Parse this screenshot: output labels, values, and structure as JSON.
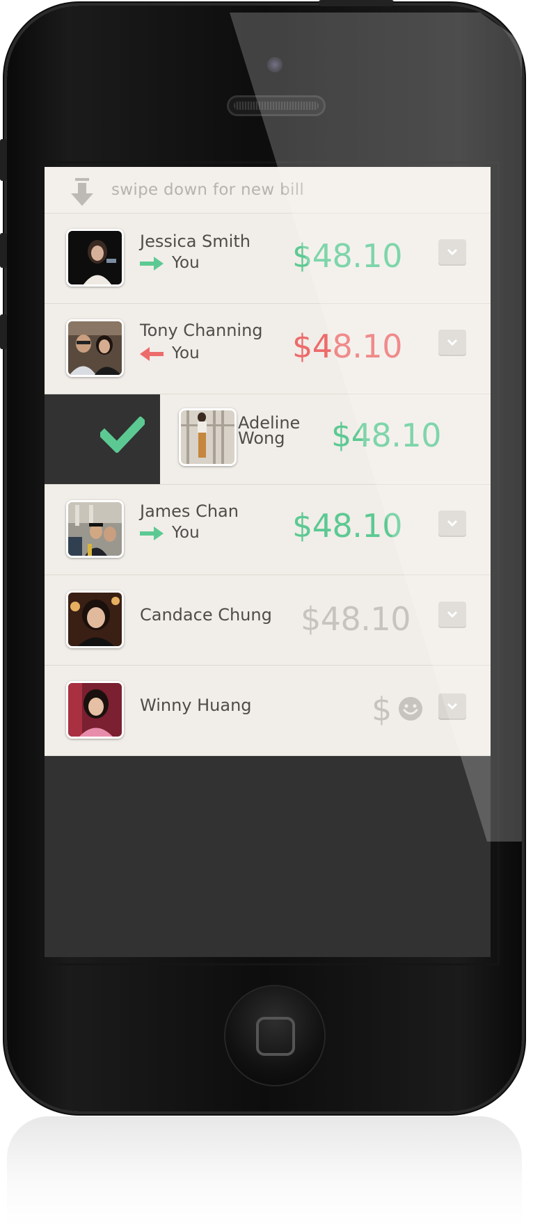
{
  "hint": {
    "text": "swipe down for new bill",
    "icon": "down-arrow-icon"
  },
  "colors": {
    "green": "#5cc993",
    "red": "#ec6b6b",
    "muted": "#c7c3bf"
  },
  "rows": [
    {
      "name": "Jessica Smith",
      "direction": "to",
      "party": "You",
      "amount": "$48.10",
      "amount_color": "green"
    },
    {
      "name": "Tony Channing",
      "direction": "from",
      "party": "You",
      "amount": "$48.10",
      "amount_color": "red"
    },
    {
      "name_line1": "Adeline",
      "name_line2": "Wong",
      "amount": "$48.10",
      "amount_color": "green",
      "state": "swiped-settled"
    },
    {
      "name": "James Chan",
      "direction": "to",
      "party": "You",
      "amount": "$48.10",
      "amount_color": "green"
    },
    {
      "name": "Candace Chung",
      "amount": "$48.10",
      "amount_color": "muted"
    },
    {
      "name": "Winny Huang",
      "amount": "$",
      "amount_color": "muted",
      "status_icon": "smiley-icon"
    }
  ]
}
